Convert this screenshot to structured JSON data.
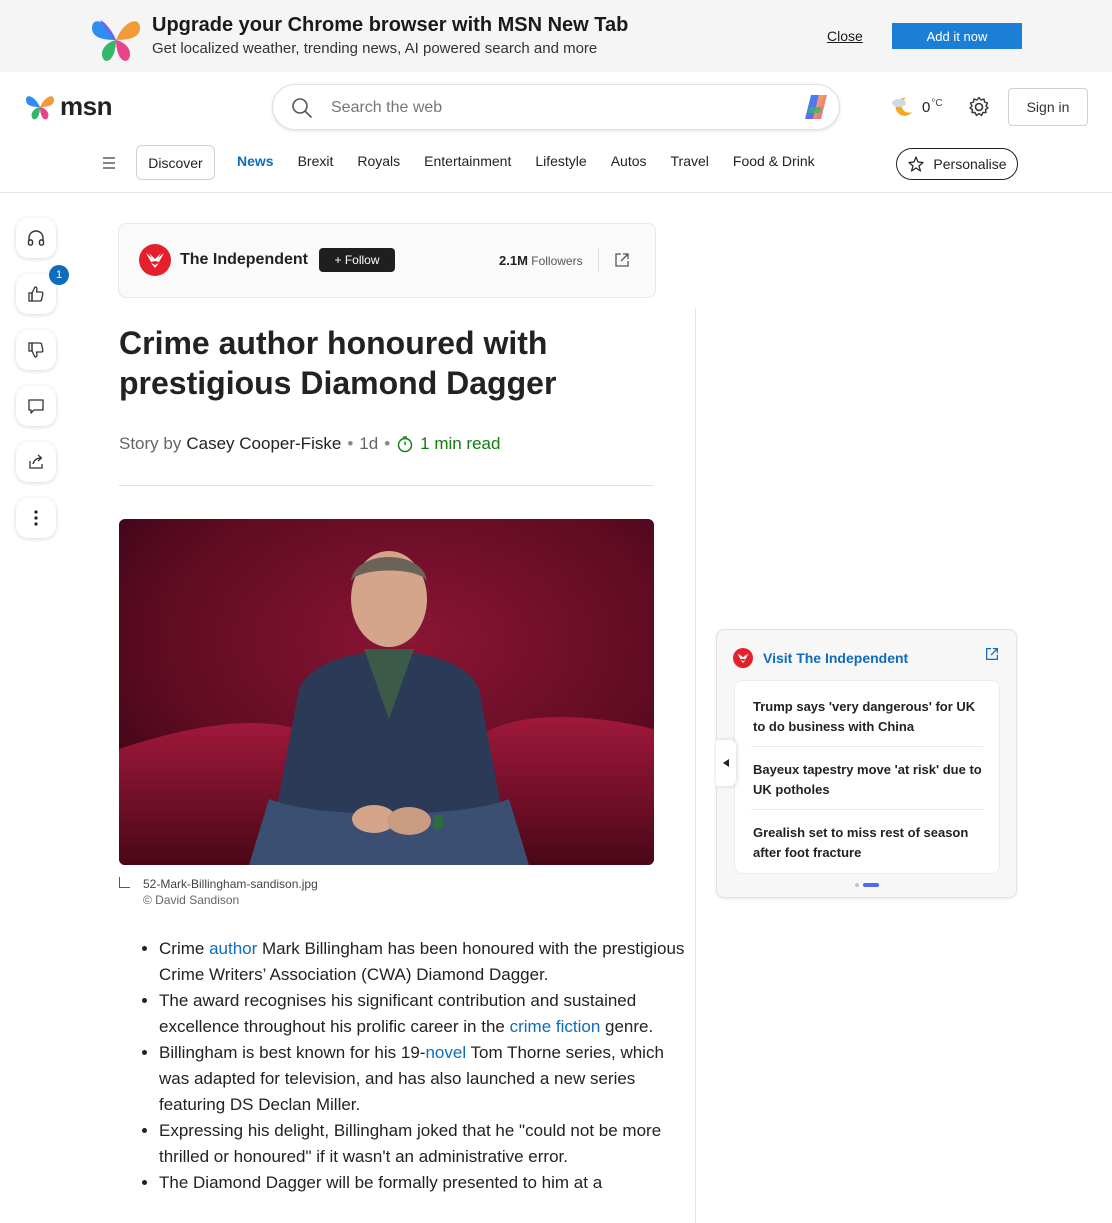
{
  "promo": {
    "title": "Upgrade your Chrome browser with MSN New Tab",
    "subtitle": "Get localized weather, trending news, AI powered search and more",
    "close_label": "Close",
    "add_label": "Add it now"
  },
  "header": {
    "logo_text": "msn",
    "search_placeholder": "Search the web",
    "weather_temp": "0",
    "weather_unit": "°C",
    "signin_label": "Sign in"
  },
  "nav": {
    "discover_label": "Discover",
    "links": [
      "News",
      "Brexit",
      "Royals",
      "Entertainment",
      "Lifestyle",
      "Autos",
      "Travel",
      "Food & Drink"
    ],
    "active": "News",
    "personalise_label": "Personalise"
  },
  "rail": {
    "like_count": "1"
  },
  "publisher": {
    "name": "The Independent",
    "follow_label": "Follow",
    "followers_count": "2.1M",
    "followers_label": "Followers"
  },
  "article": {
    "headline": "Crime author honoured with prestigious Diamond Dagger",
    "story_by": "Story by",
    "author": "Casey Cooper-Fiske",
    "age": "1d",
    "read_time": "1 min read",
    "image_filename": "52-Mark-Billingham-sandison.jpg",
    "image_credit": "© David Sandison",
    "bullets": [
      {
        "before": "Crime ",
        "link": "author",
        "after": " Mark Billingham has been honoured with the prestigious Crime Writers’ Association (CWA) Diamond Dagger."
      },
      {
        "before": "The award recognises his significant contribution and sustained excellence throughout his prolific career in the ",
        "link": "crime fiction",
        "after": " genre."
      },
      {
        "before": "Billingham is best known for his 19-",
        "link": "novel",
        "after": " Tom Thorne series, which was adapted for television, and has also launched a new series featuring DS Declan Miller."
      },
      {
        "before": "Expressing his delight, Billingham joked that he \"could not be more thrilled or honoured\" if it wasn't an administrative error.",
        "link": "",
        "after": ""
      },
      {
        "before": "The Diamond Dagger will be formally presented to him at a",
        "link": "",
        "after": ""
      }
    ]
  },
  "side_panel": {
    "title": "Visit The Independent",
    "items": [
      "Trump says 'very dangerous' for UK to do business with China",
      "Bayeux tapestry move 'at risk' due to UK potholes",
      "Grealish set to miss rest of season after foot fracture"
    ]
  },
  "colors": {
    "accent": "#0f6cbd",
    "promo_button": "#1b7fd6",
    "read_time": "#107c10",
    "independent_red": "#e4202c"
  }
}
